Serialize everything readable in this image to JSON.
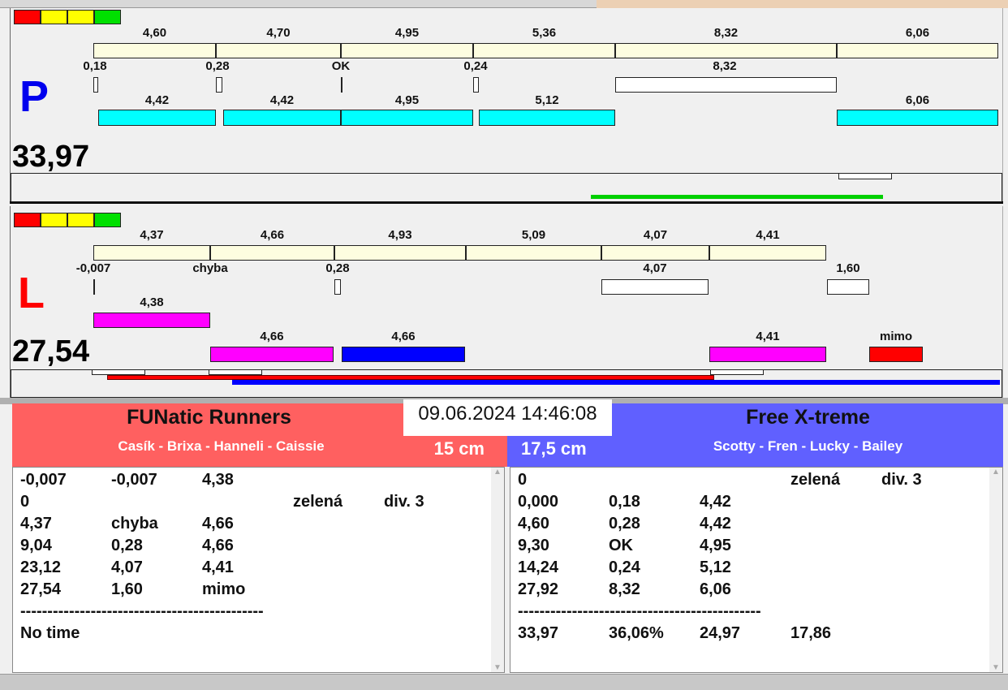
{
  "traffic_light": [
    "#ff0000",
    "#ffff00",
    "#ffff00",
    "#00e000"
  ],
  "top": {
    "letter": "P",
    "total": "33,97",
    "split_labels": [
      "4,60",
      "4,70",
      "4,95",
      "5,36",
      "8,32",
      "6,06"
    ],
    "change_labels": [
      "0,18",
      "0,28",
      "OK",
      "0,24",
      "8,32"
    ],
    "dog_labels": [
      "4,42",
      "4,42",
      "4,95",
      "5,12",
      "6,06"
    ]
  },
  "bottom": {
    "letter": "L",
    "total": "27,54",
    "split_labels": [
      "4,37",
      "4,66",
      "4,93",
      "5,09",
      "4,07",
      "4,41"
    ],
    "change_labels": [
      "-0,007",
      "chyba",
      "0,28",
      "4,07",
      "1,60"
    ],
    "dog_labels": [
      "4,38",
      "4,66",
      "4,66",
      "4,41",
      "mimo"
    ]
  },
  "datetime": "09.06.2024 14:46:08",
  "left_team": {
    "name": "FUNatic Runners",
    "dogs": "Casík - Brixa - Hanneli - Caissie",
    "height": "15 cm",
    "color": "#ff6060",
    "rows": [
      [
        "-0,007",
        "-0,007",
        "4,38",
        "",
        ""
      ],
      [
        "0",
        "",
        "",
        "zelená",
        "div. 3"
      ],
      [
        "4,37",
        "chyba",
        "4,66",
        "",
        ""
      ],
      [
        "9,04",
        "0,28",
        "4,66",
        "",
        ""
      ],
      [
        "23,12",
        "4,07",
        "4,41",
        "",
        ""
      ],
      [
        "27,54",
        "1,60",
        "mimo",
        "",
        ""
      ],
      [
        "---------------------------------------------",
        "",
        "",
        "",
        ""
      ],
      [
        "No time",
        "",
        "",
        "",
        ""
      ]
    ]
  },
  "right_team": {
    "name": "Free X-treme",
    "dogs": "Scotty - Fren - Lucky - Bailey",
    "height": "17,5 cm",
    "color": "#6060ff",
    "rows": [
      [
        "0",
        "",
        "",
        "zelená",
        "div. 3"
      ],
      [
        "0,000",
        "0,18",
        "4,42",
        "",
        ""
      ],
      [
        "4,60",
        "0,28",
        "4,42",
        "",
        ""
      ],
      [
        "9,30",
        "OK",
        "4,95",
        "",
        ""
      ],
      [
        "14,24",
        "0,24",
        "5,12",
        "",
        ""
      ],
      [
        "27,92",
        "8,32",
        "6,06",
        "",
        ""
      ],
      [
        "---------------------------------------------",
        "",
        "",
        "",
        ""
      ],
      [
        "33,97",
        "36,06%",
        "24,97",
        "17,86",
        ""
      ]
    ]
  }
}
